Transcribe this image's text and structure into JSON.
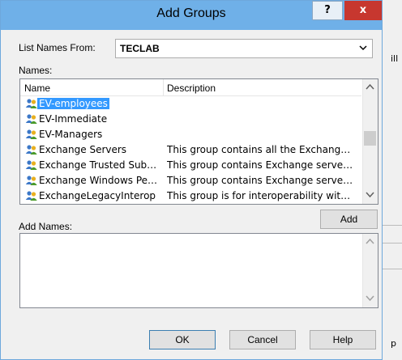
{
  "window": {
    "title": "Add Groups",
    "help_glyph": "?",
    "close_glyph": "x"
  },
  "background": {
    "text_top": "ill",
    "text_bottom": "p"
  },
  "list_names_from": {
    "label": "List Names From:",
    "value": "TECLAB"
  },
  "names": {
    "label": "Names:",
    "columns": [
      "Name",
      "Description"
    ],
    "rows": [
      {
        "name": "EV-employees",
        "description": "",
        "selected": true
      },
      {
        "name": "EV-Immediate",
        "description": ""
      },
      {
        "name": "EV-Managers",
        "description": ""
      },
      {
        "name": "Exchange Servers",
        "description": "This group contains all the Exchange servers..."
      },
      {
        "name": "Exchange Trusted Subsystem",
        "description": "This group contains Exchange servers that..."
      },
      {
        "name": "Exchange Windows Permissions",
        "description": "This group contains Exchange servers that..."
      },
      {
        "name": "ExchangeLegacyInterop",
        "description": "This group is for interoperability with Exchange..."
      }
    ]
  },
  "add_button": "Add",
  "add_names": {
    "label": "Add Names:",
    "value": ""
  },
  "footer": {
    "ok": "OK",
    "cancel": "Cancel",
    "help": "Help"
  },
  "colors": {
    "titlebar": "#6fb0e8",
    "close": "#c7372f",
    "selection": "#3399ff"
  },
  "icons": {
    "group": "group-users-icon"
  }
}
